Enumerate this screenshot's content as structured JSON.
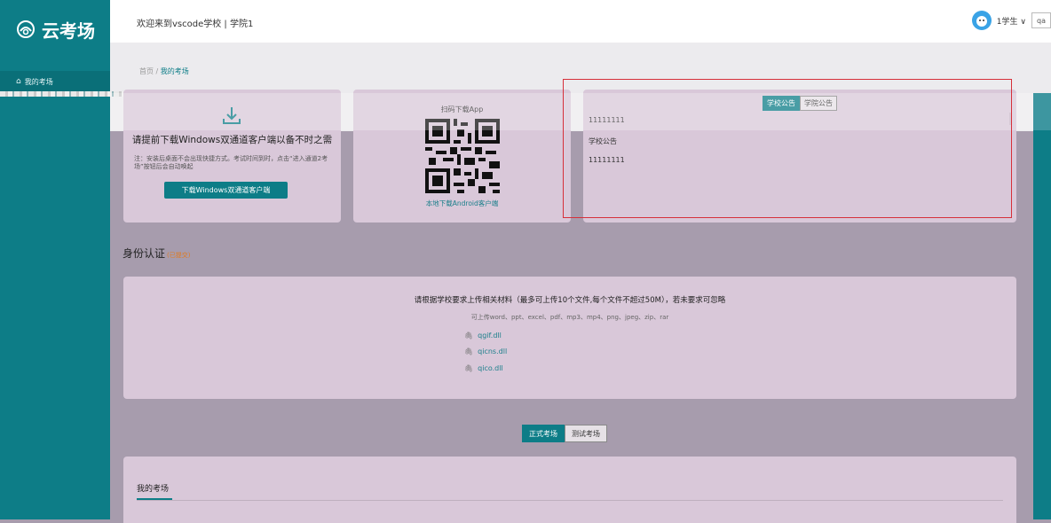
{
  "app": {
    "logo_text": "云考场"
  },
  "header": {
    "welcome": "欢迎来到vscode学校 | 学院1",
    "role": "1学生",
    "role_chevron": "∨",
    "search_text": "qa"
  },
  "sidebar": {
    "items": [
      {
        "label": "我的考场",
        "icon": "home-icon"
      }
    ]
  },
  "breadcrumb": {
    "home": "首页",
    "sep": "/",
    "current": "我的考场"
  },
  "download_card": {
    "title": "请提前下载Windows双通道客户端以备不时之需",
    "note": "注：安装后桌面不会出现快捷方式。考试时间到时，点击“进入通道2考场”按钮后会自动唤起",
    "button": "下载Windows双通道客户端"
  },
  "qr_card": {
    "title": "扫码下载App",
    "link": "本地下载Android客户端"
  },
  "notice_card": {
    "tabs": [
      {
        "label": "学校公告",
        "active": true
      },
      {
        "label": "学院公告",
        "active": false
      }
    ],
    "items": [
      "11111111",
      "学校公告",
      "11111111"
    ]
  },
  "identity": {
    "title": "身份认证",
    "status": "(已提交)"
  },
  "upload": {
    "title": "请根据学校要求上传相关材料（最多可上传10个文件,每个文件不超过50M），若未要求可忽略",
    "formats": "可上传word、ppt、excel、pdf、mp3、mp4、png、jpeg、zip、rar",
    "files": [
      "qgif.dll",
      "qicns.dll",
      "qico.dll"
    ]
  },
  "exam_tabs": [
    {
      "label": "正式考场",
      "active": true
    },
    {
      "label": "测试考场",
      "active": false
    }
  ],
  "exams": {
    "title": "我的考场"
  },
  "colors": {
    "accent": "#0d7d87",
    "highlight_box": "#d6303a",
    "status": "#e07a1e"
  }
}
